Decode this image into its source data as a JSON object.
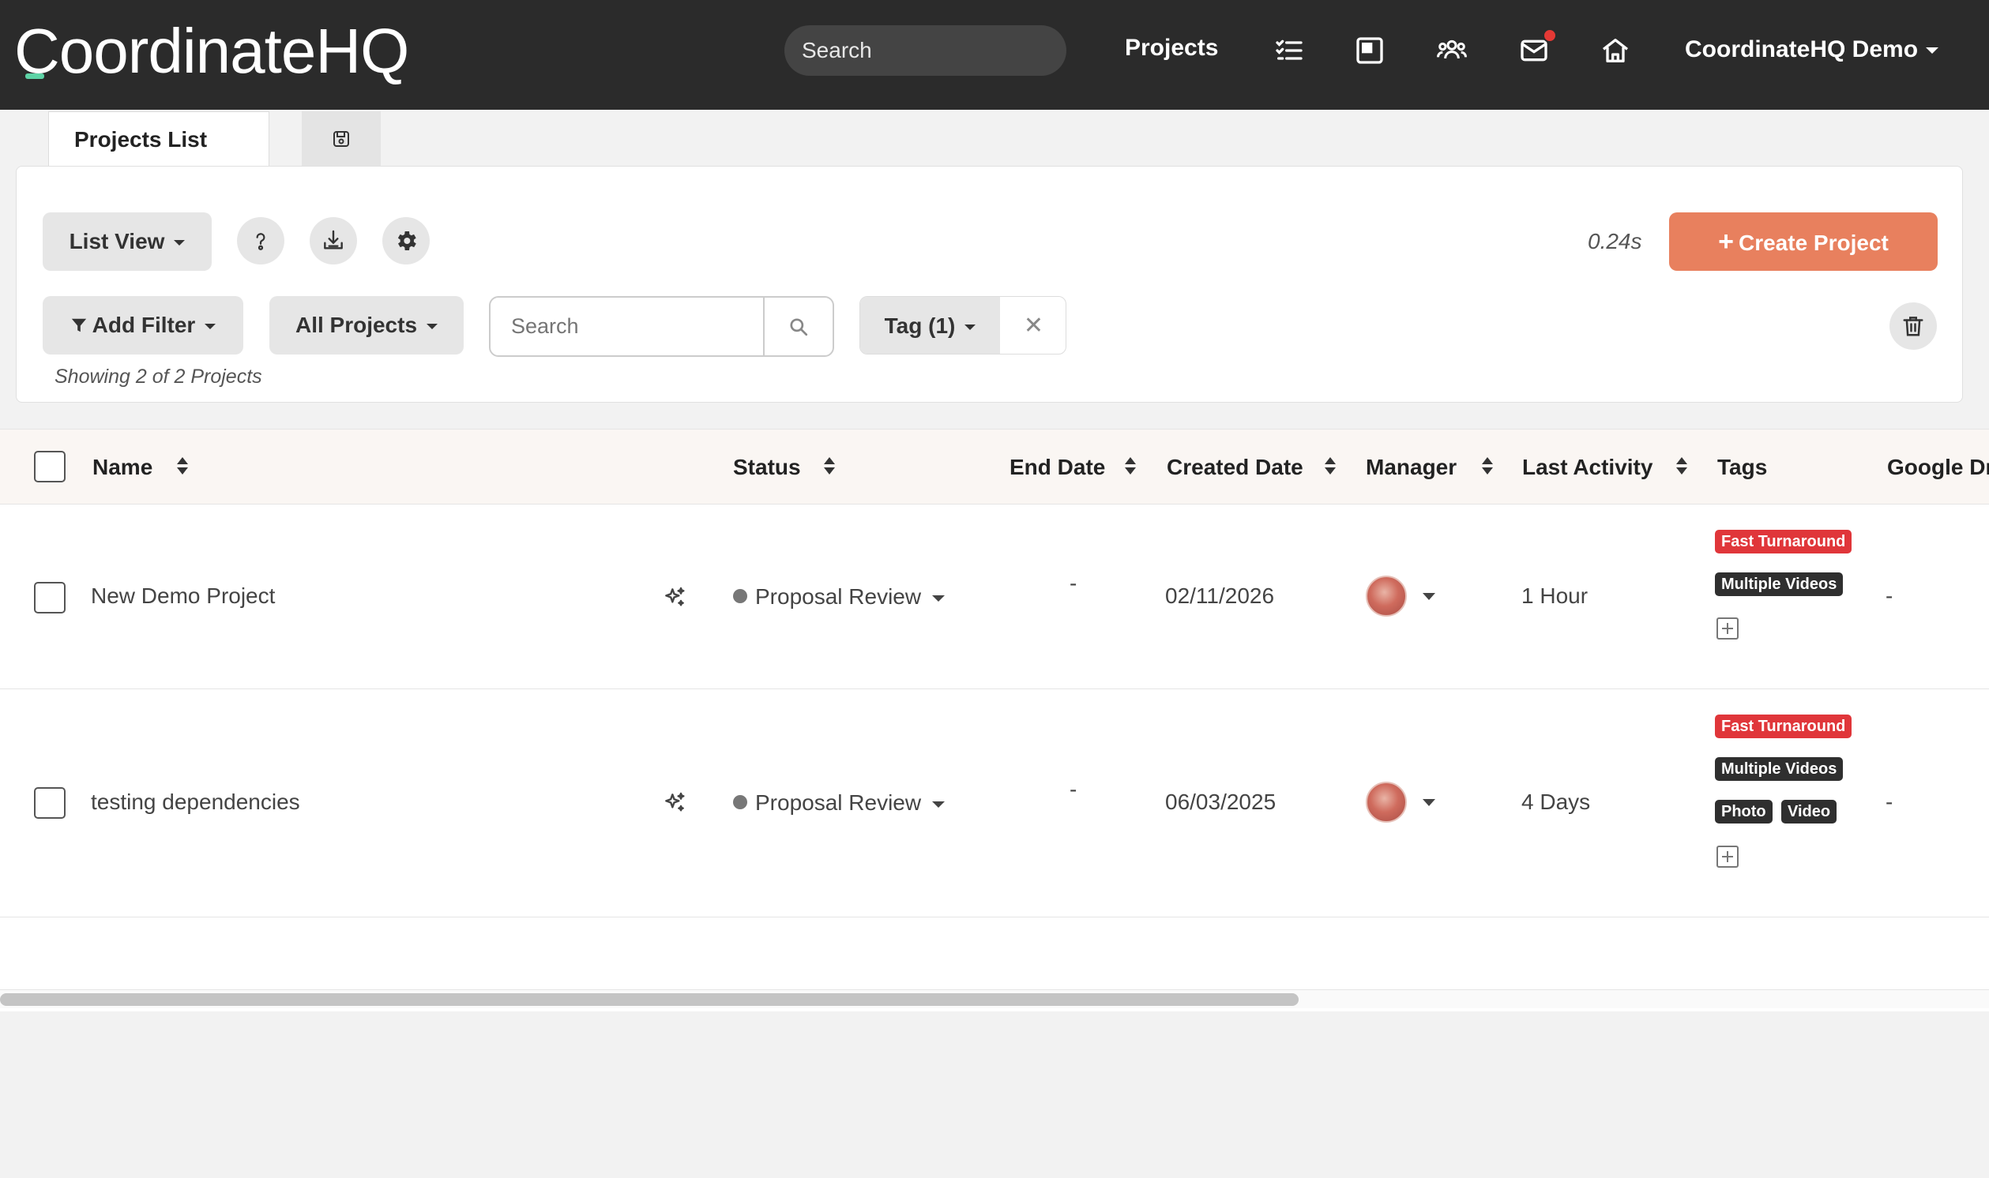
{
  "nav": {
    "logo": "CoordinateHQ",
    "search_placeholder": "Search",
    "projects_label": "Projects",
    "icons": [
      "tasks-icon",
      "board-icon",
      "team-icon",
      "mail-icon",
      "home-icon"
    ],
    "user_label": "CoordinateHQ Demo"
  },
  "tabs": [
    {
      "label": "Projects List",
      "active": true
    },
    {
      "icon": "save-icon"
    }
  ],
  "toolbar": {
    "view_label": "List View",
    "timing": "0.24s",
    "create_label": "Create Project",
    "add_filter_label": "Add Filter",
    "all_projects_label": "All Projects",
    "search_placeholder": "Search",
    "tag_filter_label": "Tag (1)",
    "showing_text": "Showing 2 of 2 Projects"
  },
  "colors": {
    "accent": "#e8805e",
    "nav_bg": "#2b2b2b",
    "tag_red": "#e0363a",
    "tag_dark": "#2f2f2f",
    "notification": "#e53935"
  },
  "table": {
    "columns": [
      "Name",
      "Status",
      "End Date",
      "Created Date",
      "Manager",
      "Last Activity",
      "Tags",
      "Google Dr"
    ],
    "rows": [
      {
        "name": "New Demo Project",
        "status": "Proposal Review",
        "end_date": "-",
        "created_date": "02/11/2026",
        "last_activity": "1 Hour",
        "tags": [
          "Fast Turnaround",
          "Multiple Videos"
        ],
        "google_drive": "-"
      },
      {
        "name": "testing dependencies",
        "status": "Proposal Review",
        "end_date": "-",
        "created_date": "06/03/2025",
        "last_activity": "4 Days",
        "tags": [
          "Fast Turnaround",
          "Multiple Videos",
          "Photo",
          "Video"
        ],
        "google_drive": "-"
      }
    ]
  }
}
